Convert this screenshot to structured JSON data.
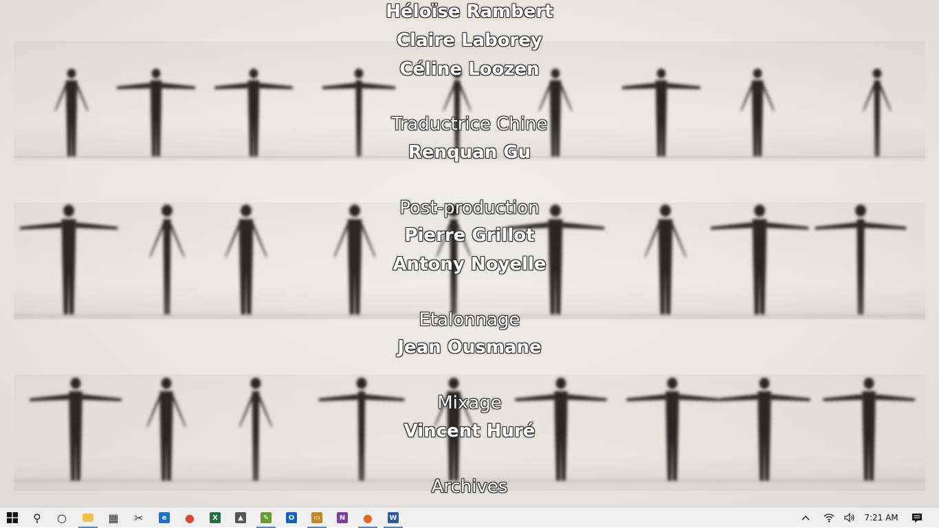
{
  "video": {
    "credits": [
      {
        "text": "Héloïse Rambert",
        "style": "name"
      },
      {
        "text": "Claire Laborey",
        "style": "name"
      },
      {
        "text": "Céline Loozen",
        "style": "name"
      },
      {
        "text": "Traductrice Chine",
        "style": "role"
      },
      {
        "text": "Renquan Gu",
        "style": "name"
      },
      {
        "text": "Post-production",
        "style": "role"
      },
      {
        "text": "Pierre Grillot",
        "style": "name"
      },
      {
        "text": "Antony Noyelle",
        "style": "name"
      },
      {
        "text": "Etalonnage",
        "style": "role"
      },
      {
        "text": "Jean Ousmane",
        "style": "name"
      },
      {
        "text": "Mixage",
        "style": "role"
      },
      {
        "text": "Vincent Huré",
        "style": "name"
      },
      {
        "text": "Archives",
        "style": "role"
      }
    ]
  },
  "taskbar": {
    "start_icon": "windows-logo-icon",
    "items": [
      {
        "name": "search-icon",
        "glyph": "⚲",
        "color": "#222222"
      },
      {
        "name": "cortana-icon",
        "glyph": "○",
        "color": "#222222"
      },
      {
        "name": "file-explorer-icon",
        "glyph": "",
        "color": "#f2c14e"
      },
      {
        "name": "calendar-icon",
        "glyph": "▦",
        "color": "#333333"
      },
      {
        "name": "snipping-tool-icon",
        "glyph": "✂",
        "color": "#333333"
      },
      {
        "name": "edge-icon",
        "glyph": "e",
        "color": "#1e6fd9"
      },
      {
        "name": "chrome-icon",
        "glyph": "●",
        "color": "#db4437"
      },
      {
        "name": "excel-icon",
        "glyph": "X",
        "color": "#1d7044"
      },
      {
        "name": "app-icon",
        "glyph": "▲",
        "color": "#555555"
      },
      {
        "name": "notepad-icon",
        "glyph": "✎",
        "color": "#6a9a2f"
      },
      {
        "name": "outlook-icon",
        "glyph": "O",
        "color": "#0a64c2"
      },
      {
        "name": "app-window-icon",
        "glyph": "▭",
        "color": "#c38a1e"
      },
      {
        "name": "onenote-icon",
        "glyph": "N",
        "color": "#7b3ca6"
      },
      {
        "name": "firefox-icon",
        "glyph": "●",
        "color": "#e8641f"
      },
      {
        "name": "word-icon",
        "glyph": "W",
        "color": "#2b5aa8"
      }
    ],
    "tray": {
      "chevron_icon": "chevron-up-icon",
      "network_icon": "wifi-icon",
      "volume_icon": "volume-icon",
      "time": "7:21 AM",
      "notifications_icon": "notifications-icon"
    }
  }
}
